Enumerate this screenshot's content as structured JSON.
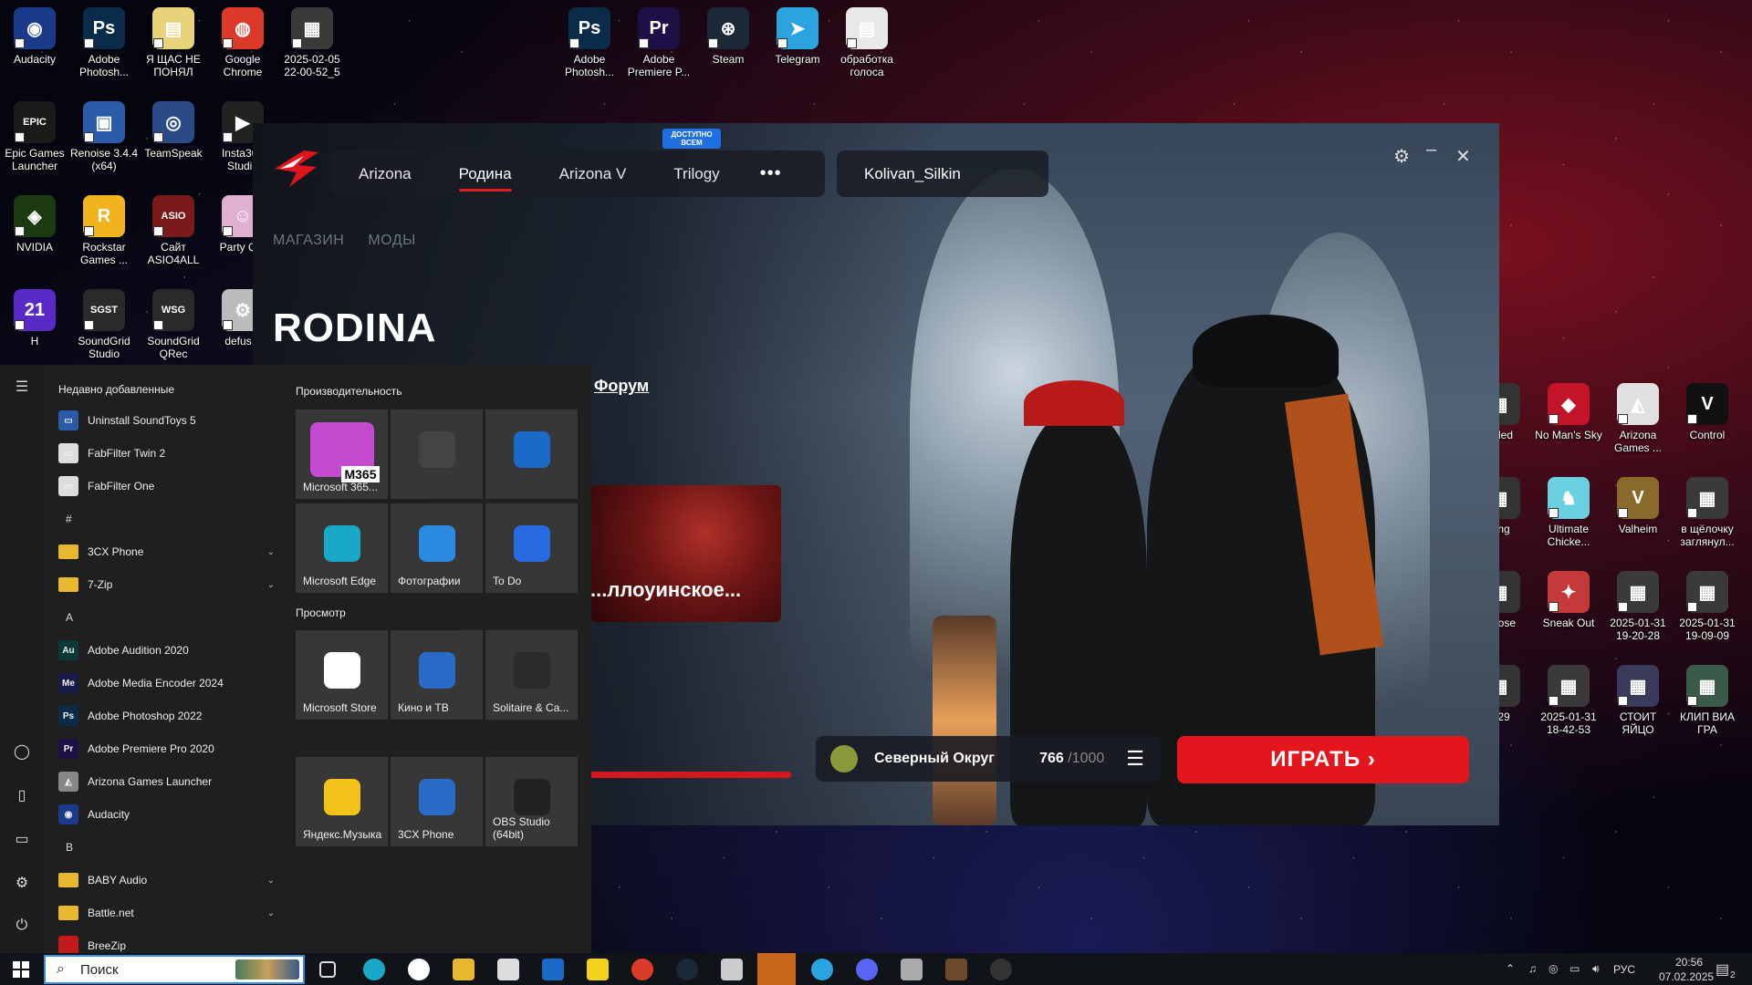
{
  "desktop_icons": [
    {
      "label": "Audacity",
      "color": "#1a3a8a",
      "glyph": "◉"
    },
    {
      "label": "Adobe Photosh...",
      "color": "#0b2b4a",
      "glyph": "Ps"
    },
    {
      "label": "Я ЩАС НЕ ПОНЯЛ",
      "color": "#e8d27a",
      "glyph": "▤"
    },
    {
      "label": "Google Chrome",
      "color": "#db3a2a",
      "glyph": "◍"
    },
    {
      "label": "2025-02-05 22-00-52_5",
      "color": "#3a3a3a",
      "glyph": "▦"
    },
    {
      "label": "Adobe Photosh...",
      "color": "#0b2b4a",
      "glyph": "Ps"
    },
    {
      "label": "Adobe Premiere P...",
      "color": "#1c1044",
      "glyph": "Pr"
    },
    {
      "label": "Steam",
      "color": "#1b2838",
      "glyph": "⊛"
    },
    {
      "label": "Telegram",
      "color": "#2aa3df",
      "glyph": "➤"
    },
    {
      "label": "обработка голоса",
      "color": "#e8e8e8",
      "glyph": "▤"
    },
    {
      "label": "Epic Games Launcher",
      "color": "#1a1a1a",
      "glyph": "EPIC"
    },
    {
      "label": "Renoise 3.4.4 (x64)",
      "color": "#2a5aa8",
      "glyph": "▣"
    },
    {
      "label": "TeamSpeak",
      "color": "#2a4a88",
      "glyph": "◎"
    },
    {
      "label": "Insta360 Studio",
      "color": "#222",
      "glyph": "▶"
    },
    {
      "label": "NVIDIA",
      "color": "#1a3a10",
      "glyph": "◈"
    },
    {
      "label": "Rockstar Games ...",
      "color": "#f2b41e",
      "glyph": "R"
    },
    {
      "label": "Сайт ASIO4ALL",
      "color": "#7a1a1a",
      "glyph": "ASIO"
    },
    {
      "label": "Party Q...",
      "color": "#e0b0d0",
      "glyph": "☺"
    },
    {
      "label": "H",
      "color": "#5a2ac8",
      "glyph": "21"
    },
    {
      "label": "SoundGrid Studio",
      "color": "#2a2a2a",
      "glyph": "SGST"
    },
    {
      "label": "SoundGrid QRec",
      "color": "#2a2a2a",
      "glyph": "WSG"
    },
    {
      "label": "defus...",
      "color": "#bbb",
      "glyph": "⚙"
    },
    {
      "label": "...ded",
      "color": "#333",
      "glyph": "▦"
    },
    {
      "label": "No Man's Sky",
      "color": "#c4142a",
      "glyph": "◆"
    },
    {
      "label": "Arizona Games ...",
      "color": "#e0e0e0",
      "glyph": "◭"
    },
    {
      "label": "Control",
      "color": "#111",
      "glyph": "V"
    },
    {
      "label": "...ng",
      "color": "#333",
      "glyph": "▦"
    },
    {
      "label": "Ultimate Chicke...",
      "color": "#6ad0e0",
      "glyph": "♞"
    },
    {
      "label": "Valheim",
      "color": "#8a6a2a",
      "glyph": "V"
    },
    {
      "label": "в щёлочку заглянул...",
      "color": "#3a3a3a",
      "glyph": "▦"
    },
    {
      "label": "...oose",
      "color": "#333",
      "glyph": "▦"
    },
    {
      "label": "Sneak Out",
      "color": "#c43a3a",
      "glyph": "✦"
    },
    {
      "label": "2025-01-31 19-20-28",
      "color": "#3a3a3a",
      "glyph": "▦"
    },
    {
      "label": "2025-01-31 19-09-09",
      "color": "#3a3a3a",
      "glyph": "▦"
    },
    {
      "label": "...29",
      "color": "#333",
      "glyph": "▦"
    },
    {
      "label": "2025-01-31 18-42-53",
      "color": "#3a3a3a",
      "glyph": "▦"
    },
    {
      "label": "СТОИТ ЯЙЦО",
      "color": "#3a3a5a",
      "glyph": "▦"
    },
    {
      "label": "КЛИП ВИА ГРА",
      "color": "#3a5a4a",
      "glyph": "▦"
    }
  ],
  "launcher": {
    "tabs": [
      "Arizona",
      "Родина",
      "Arizona V",
      "Trilogy"
    ],
    "active_tab": "Родина",
    "badge": "ДОСТУПНО ВСЕМ",
    "more": "•••",
    "username": "Kolivan_Silkin",
    "subnav": [
      "МАГАЗИН",
      "МОДЫ"
    ],
    "title": "RODINA",
    "forum_link": "Форум",
    "news_title": "...ллоуинское...",
    "server_name": "Северный Округ",
    "server_online": "766",
    "server_max": "/1000",
    "play_button": "ИГРАТЬ ›",
    "settings_icon": "⚙",
    "minimize_icon": "–",
    "close_icon": "✕"
  },
  "start_menu": {
    "recent_header": "Недавно добавленные",
    "apps": [
      {
        "label": "Uninstall SoundToys 5",
        "icon": "▭",
        "color": "#2a5aa8",
        "kind": "app"
      },
      {
        "label": "FabFilter Twin 2",
        "icon": "▭",
        "color": "#ddd",
        "kind": "app"
      },
      {
        "label": "FabFilter One",
        "icon": "▭",
        "color": "#ddd",
        "kind": "app"
      },
      {
        "label": "#",
        "kind": "letter"
      },
      {
        "label": "3CX Phone",
        "icon": "",
        "color": "#e8b830",
        "kind": "folder"
      },
      {
        "label": "7-Zip",
        "icon": "",
        "color": "#e8b830",
        "kind": "folder"
      },
      {
        "label": "A",
        "kind": "letter"
      },
      {
        "label": "Adobe Audition 2020",
        "icon": "Au",
        "color": "#0a3a38",
        "kind": "app"
      },
      {
        "label": "Adobe Media Encoder 2024",
        "icon": "Me",
        "color": "#1a1a4a",
        "kind": "app"
      },
      {
        "label": "Adobe Photoshop 2022",
        "icon": "Ps",
        "color": "#0b2b4a",
        "kind": "app"
      },
      {
        "label": "Adobe Premiere Pro 2020",
        "icon": "Pr",
        "color": "#1c1044",
        "kind": "app"
      },
      {
        "label": "Arizona Games Launcher",
        "icon": "◭",
        "color": "#888",
        "kind": "app"
      },
      {
        "label": "Audacity",
        "icon": "◉",
        "color": "#1a3a8a",
        "kind": "app"
      },
      {
        "label": "B",
        "kind": "letter"
      },
      {
        "label": "BABY Audio",
        "icon": "",
        "color": "#e8b830",
        "kind": "folder"
      },
      {
        "label": "Battle.net",
        "icon": "",
        "color": "#e8b830",
        "kind": "folder"
      },
      {
        "label": "BreeZip",
        "icon": "",
        "color": "#c41a1a",
        "kind": "app"
      }
    ],
    "group1": "Производительность",
    "group2": "Просмотр",
    "tiles": [
      {
        "label": "Microsoft 365...",
        "color": "#c44ad0",
        "badge": "M365"
      },
      {
        "label": "",
        "color": "#444",
        "badge": ""
      },
      {
        "label": "",
        "color": "#1a6ac8",
        "badge": ""
      },
      {
        "label": "Microsoft Edge",
        "color": "#1aa8c8",
        "badge": ""
      },
      {
        "label": "Фотографии",
        "color": "#2a8ae0",
        "badge": ""
      },
      {
        "label": "To Do",
        "color": "#2a6ae0",
        "badge": ""
      },
      {
        "label": "Microsoft Store",
        "color": "#fff",
        "badge": ""
      },
      {
        "label": "Кино и ТВ",
        "color": "#2a6ac8",
        "badge": ""
      },
      {
        "label": "Solitaire & Ca...",
        "color": "#2a2a2a",
        "badge": ""
      },
      {
        "label": "Яндекс.Музыка",
        "color": "#f2c21a",
        "badge": ""
      },
      {
        "label": "3CX Phone",
        "color": "#2a6ac8",
        "badge": ""
      },
      {
        "label": "OBS Studio (64bit)",
        "color": "#222",
        "badge": ""
      }
    ]
  },
  "taskbar": {
    "search_placeholder": "Поиск",
    "lang": "РУС",
    "time": "20:56",
    "date": "07.02.2025",
    "notif_count": "2"
  }
}
